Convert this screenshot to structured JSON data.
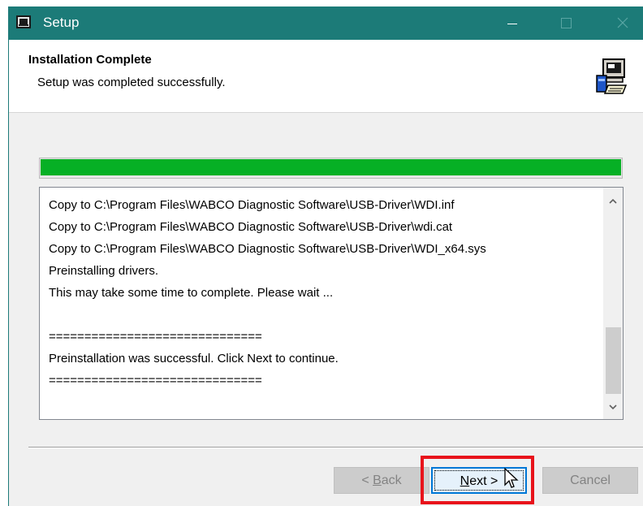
{
  "window": {
    "title": "Setup",
    "titlebar_color": "#1c7b78",
    "buttons": [
      "minimize-icon",
      "maximize-icon",
      "close-icon"
    ]
  },
  "header": {
    "title": "Installation Complete",
    "subtitle": "Setup was completed successfully.",
    "icon": "setup-computer-icon"
  },
  "progress": {
    "percent": 100,
    "color": "#06b025"
  },
  "log": {
    "lines": [
      "Copy to C:\\Program Files\\WABCO Diagnostic Software\\USB-Driver\\WDI.inf",
      "Copy to C:\\Program Files\\WABCO Diagnostic Software\\USB-Driver\\wdi.cat",
      "Copy to C:\\Program Files\\WABCO Diagnostic Software\\USB-Driver\\WDI_x64.sys",
      "Preinstalling drivers.",
      "This may take some time to complete. Please wait ...",
      "",
      "==============================",
      "Preinstallation was successful. Click Next to continue.",
      "=============================="
    ]
  },
  "buttons": {
    "back_prefix": "< ",
    "back_key": "B",
    "back_rest": "ack",
    "next_key": "N",
    "next_rest": "ext >",
    "cancel": "Cancel"
  },
  "annotation": {
    "highlight_color": "#e8131b"
  }
}
